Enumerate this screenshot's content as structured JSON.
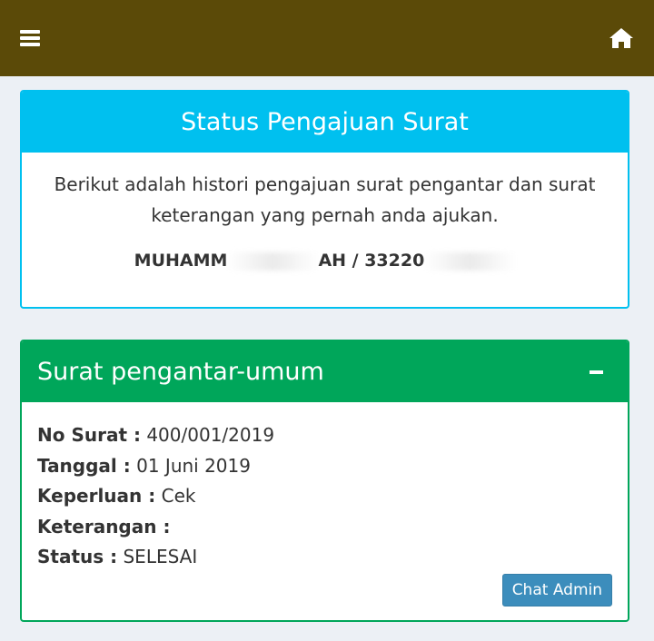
{
  "navbar": {
    "menu_icon": "hamburger-menu-icon",
    "home_icon": "home-icon",
    "bg_color": "#5b4a08"
  },
  "status_box": {
    "title": "Status Pengajuan Surat",
    "intro": "Berikut adalah histori pengajuan surat pengantar dan surat keterangan yang pernah anda ajukan.",
    "identity_left": "MUHAMM",
    "identity_mid": "AH / 33220",
    "accent_color": "#00c0ef"
  },
  "surat_box": {
    "title": "Surat pengantar-umum",
    "accent_color": "#00a65a",
    "fields": [
      {
        "label": "No Surat :",
        "value": "400/001/2019"
      },
      {
        "label": "Tanggal :",
        "value": "01 Juni 2019"
      },
      {
        "label": "Keperluan :",
        "value": "Cek"
      },
      {
        "label": "Keterangan :",
        "value": ""
      },
      {
        "label": "Status :",
        "value": "SELESAI"
      }
    ],
    "chat_button": "Chat Admin"
  }
}
